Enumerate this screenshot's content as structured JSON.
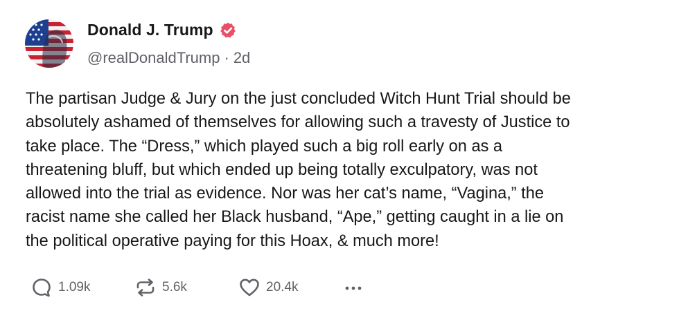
{
  "post": {
    "author": {
      "display_name": "Donald J. Trump",
      "handle": "@realDonaldTrump",
      "verified_icon": "verified-badge-icon",
      "accent_color": "#e8506a"
    },
    "separator": "·",
    "timestamp": "2d",
    "body": {
      "lines": [
        "The partisan Judge & Jury on the just concluded Witch Hunt Trial should be",
        "absolutely ashamed of themselves for allowing such a travesty of Justice to",
        "take place. The “Dress,” which played such a big roll early on as a",
        "threatening bluff, but which ended up being totally exculpatory, was not",
        "allowed into the trial as evidence. Nor was her cat’s name, “Vagina,” the",
        "racist name she called her Black husband, “Ape,” getting caught in a lie on",
        "the political operative paying for this Hoax, & much more!"
      ]
    },
    "actions": {
      "replies": {
        "icon": "reply-icon",
        "count": "1.09k"
      },
      "retruths": {
        "icon": "retruth-icon",
        "count": "5.6k"
      },
      "likes": {
        "icon": "heart-icon",
        "count": "20.4k"
      },
      "more": {
        "icon": "more-icon"
      }
    }
  }
}
